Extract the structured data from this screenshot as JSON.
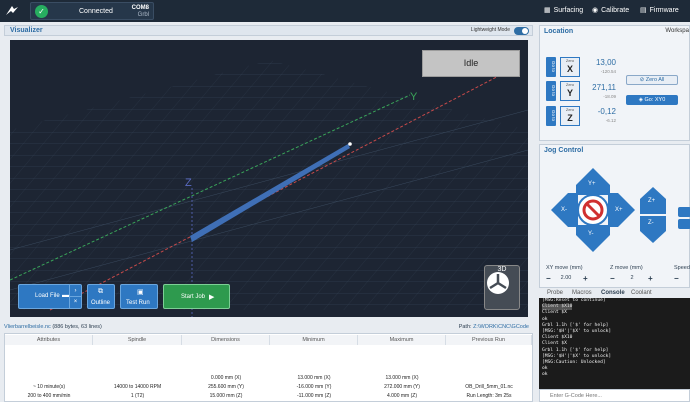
{
  "app": {
    "connection_status": "Connected",
    "port_name": "COM8",
    "firmware": "Grbl",
    "nav": [
      {
        "label": "Surfacing",
        "icon": "surfacing-icon"
      },
      {
        "label": "Calibrate",
        "icon": "calibrate-icon"
      },
      {
        "label": "Firmware",
        "icon": "firmware-icon"
      }
    ]
  },
  "visualizer": {
    "title": "Visualizer",
    "lightweight_label": "Lightweight Mode",
    "state": "Idle",
    "axis_labels": {
      "x": "X",
      "y": "Y",
      "z": "Z"
    },
    "buttons": {
      "load_file": "Load File",
      "outline": "Outline",
      "test_run": "Test Run",
      "start_job": "Start Job",
      "view_3d": "3D"
    }
  },
  "file": {
    "name": "Vlierbarrelbeisle.nc",
    "info": "(886 bytes, 63 lines)",
    "path_label": "Path:",
    "path": "Z:\\WORK\\CNC\\GCode"
  },
  "stats": {
    "headers": [
      "Attributes",
      "Spindle",
      "Dimensions",
      "Minimum",
      "Maximum",
      "Previous Run"
    ],
    "rows": [
      [
        "",
        "",
        "0.000 mm (X)",
        "13.000 mm (X)",
        "13.000 mm (X)",
        ""
      ],
      [
        "~ 10 minute(s)",
        "14000 to 14000 RPM",
        "255.600 mm (Y)",
        "-16.000 mm (Y)",
        "272.000 mm (Y)",
        "OB_Drill_5mm_01.nc"
      ],
      [
        "200 to 400 mm/min",
        "1 (T2)",
        "15.000 mm (Z)",
        "-11.000 mm (Z)",
        "4.000 mm (Z)",
        "Run Length: 3m 25s"
      ]
    ]
  },
  "location": {
    "title": "Location",
    "workspace_label": "Workspa",
    "goto_label": "Go to",
    "zero_label": "Zero",
    "axes": [
      {
        "axis": "X",
        "value": "13,00",
        "machine": "-120.54"
      },
      {
        "axis": "Y",
        "value": "271,11",
        "machine": "-18.09"
      },
      {
        "axis": "Z",
        "value": "-0,12",
        "machine": "-6.12"
      }
    ],
    "zero_all": "Zero All",
    "go_xy0": "Go: XY0"
  },
  "jog": {
    "title": "Jog Control",
    "labels": {
      "y_plus": "Y+",
      "y_minus": "Y-",
      "x_plus": "X+",
      "x_minus": "X-",
      "z_plus": "Z+",
      "z_minus": "Z-"
    },
    "xy_move_label": "XY move (mm)",
    "z_move_label": "Z move (mm)",
    "speed_label": "Speed",
    "xy_move": "2.00",
    "z_move": "2"
  },
  "console": {
    "tabs": [
      "Probe",
      "Macros",
      "Console",
      "Coolant"
    ],
    "active_tab": "Console",
    "lines": [
      "[MSG:Reset to continue]",
      "Client $X10",
      "Client $X",
      "ok",
      "Grbl 1.1h ['$' for help]",
      "[MSG:'$H'|'$X' to unlock]",
      "Client $X10",
      "Client $X",
      "Grbl 1.1h ['$' for help]",
      "[MSG:'$H'|'$X' to unlock]",
      "[MSG:Caution: Unlocked]",
      "ok",
      "ok"
    ],
    "input_placeholder": "Enter G-Code Here..."
  }
}
